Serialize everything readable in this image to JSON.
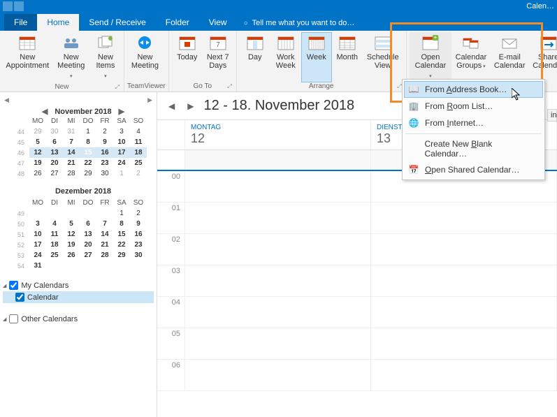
{
  "app_title_suffix": "Calen…",
  "tabs": {
    "file": "File",
    "home": "Home",
    "sendreceive": "Send / Receive",
    "folder": "Folder",
    "view": "View",
    "tellme": "Tell me what you want to do…"
  },
  "ribbon": {
    "new_appointment": "New\nAppointment",
    "new_meeting": "New\nMeeting",
    "new_items": "New\nItems",
    "group_new": "New",
    "new_tv_meeting": "New\nMeeting",
    "group_tv": "TeamViewer",
    "today": "Today",
    "next7": "Next 7\nDays",
    "group_goto": "Go To",
    "day": "Day",
    "work_week": "Work\nWeek",
    "week": "Week",
    "month": "Month",
    "schedule_view": "Schedule\nView",
    "group_arrange": "Arrange",
    "open_calendar": "Open\nCalendar",
    "calendar_groups": "Calendar\nGroups",
    "email_calendar": "E-mail\nCalendar",
    "share_calendar": "Share\nCalendar"
  },
  "mini1": {
    "title": "November 2018",
    "dow": [
      "MO",
      "DI",
      "MI",
      "DO",
      "FR",
      "SA",
      "SO"
    ],
    "weeks": [
      {
        "wk": "44",
        "days": [
          "29",
          "30",
          "31",
          "1",
          "2",
          "3",
          "4"
        ],
        "gray": [
          0,
          1,
          2
        ]
      },
      {
        "wk": "45",
        "days": [
          "5",
          "6",
          "7",
          "8",
          "9",
          "10",
          "11"
        ],
        "bold": true
      },
      {
        "wk": "46",
        "days": [
          "12",
          "13",
          "14",
          "15",
          "16",
          "17",
          "18"
        ],
        "bold": true,
        "range": true,
        "today": 3
      },
      {
        "wk": "47",
        "days": [
          "19",
          "20",
          "21",
          "22",
          "23",
          "24",
          "25"
        ],
        "bold": true
      },
      {
        "wk": "48",
        "days": [
          "26",
          "27",
          "28",
          "29",
          "30",
          "1",
          "2"
        ],
        "gray": [
          5,
          6
        ]
      }
    ]
  },
  "mini2": {
    "title": "Dezember 2018",
    "dow": [
      "MO",
      "DI",
      "MI",
      "DO",
      "FR",
      "SA",
      "SO"
    ],
    "weeks": [
      {
        "wk": "49",
        "days": [
          "",
          "",
          "",
          "",
          "",
          "1",
          "2"
        ]
      },
      {
        "wk": "50",
        "days": [
          "3",
          "4",
          "5",
          "6",
          "7",
          "8",
          "9"
        ],
        "bold": true
      },
      {
        "wk": "51",
        "days": [
          "10",
          "11",
          "12",
          "13",
          "14",
          "15",
          "16"
        ],
        "bold": true
      },
      {
        "wk": "52",
        "days": [
          "17",
          "18",
          "19",
          "20",
          "21",
          "22",
          "23"
        ],
        "bold": true
      },
      {
        "wk": "53",
        "days": [
          "24",
          "25",
          "26",
          "27",
          "28",
          "29",
          "30"
        ],
        "bold": true
      },
      {
        "wk": "54",
        "days": [
          "31",
          "",
          "",
          "",
          "",
          "",
          ""
        ],
        "bold": true
      }
    ]
  },
  "cal_groups": {
    "mine": "My Calendars",
    "cal": "Calendar",
    "other": "Other Calendars"
  },
  "main_range": "12 - 18. November 2018",
  "days": [
    {
      "name": "MONTAG",
      "num": "12"
    },
    {
      "name": "DIENSTAG",
      "num": "13"
    }
  ],
  "hours": [
    "00",
    "01",
    "02",
    "03",
    "04",
    "05",
    "06"
  ],
  "menu": {
    "address_book": "From Address Book…",
    "room_list": "From Room List…",
    "internet": "From Internet…",
    "blank": "Create New Blank Calendar…",
    "shared": "Open Shared Calendar…"
  },
  "peek_label": "in"
}
